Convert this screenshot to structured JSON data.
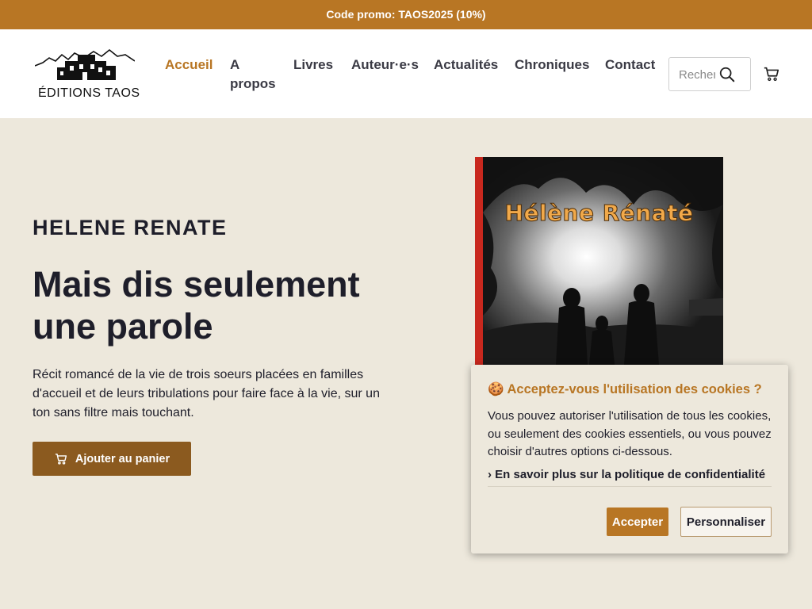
{
  "promo": {
    "text": "Code promo: TAOS2025 (10%)"
  },
  "logo": {
    "text": "ÉDITIONS TAOS"
  },
  "nav": {
    "items": [
      {
        "label": "Accueil",
        "active": true
      },
      {
        "label": "A propos"
      },
      {
        "label": "Livres"
      },
      {
        "label": "Auteur·e·s"
      },
      {
        "label": "Actualités"
      },
      {
        "label": "Chroniques"
      },
      {
        "label": "Contact"
      }
    ]
  },
  "search": {
    "placeholder": "Rechercher"
  },
  "hero": {
    "author": "HELENE RENATE",
    "title": "Mais dis seulement une parole",
    "description": "Récit romancé de la vie de trois soeurs placées en familles d'accueil et de leurs tribulations pour faire face à la vie, sur un ton sans filtre mais touchant.",
    "add_to_cart": "Ajouter au panier"
  },
  "cover": {
    "title": "Hélène Rénaté"
  },
  "cookie": {
    "title": "🍪 Acceptez-vous l'utilisation des cookies ?",
    "body": "Vous pouvez autoriser l'utilisation de tous les cookies, ou seulement des cookies essentiels, ou vous pouvez choisir d'autres options ci-dessous.",
    "privacy_link": "› En savoir plus sur la politique de confidentialité",
    "accept": "Accepter",
    "customize": "Personnaliser"
  },
  "colors": {
    "accent": "#b87624",
    "button_dark": "#8b5a1f",
    "background": "#ede8dc"
  }
}
